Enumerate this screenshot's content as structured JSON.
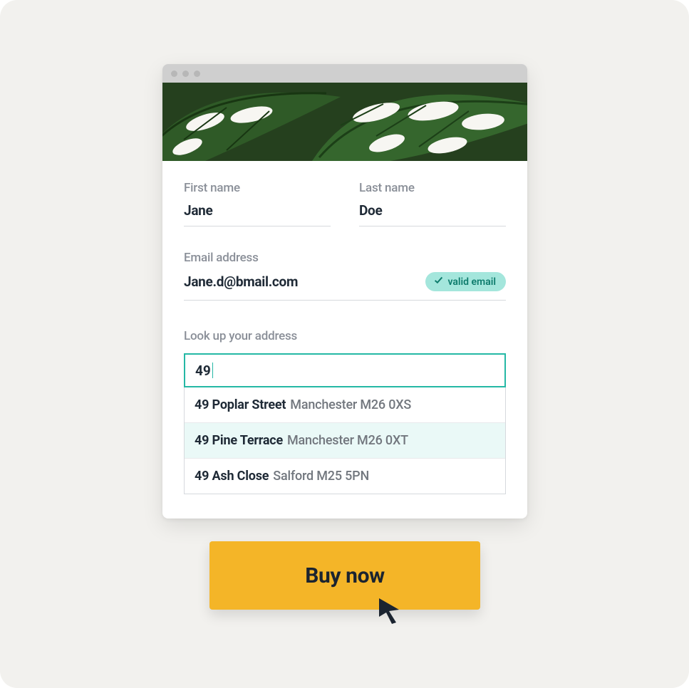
{
  "form": {
    "first_name": {
      "label": "First name",
      "value": "Jane"
    },
    "last_name": {
      "label": "Last name",
      "value": "Doe"
    },
    "email": {
      "label": "Email address",
      "value": "Jane.d@bmail.com",
      "valid_badge": "valid email"
    },
    "address": {
      "label": "Look up your address",
      "query": "49",
      "suggestions": [
        {
          "bold": "49 Poplar Street",
          "rest": "Manchester M26 0XS",
          "highlighted": false
        },
        {
          "bold": "49 Pine Terrace",
          "rest": "Manchester M26 0XT",
          "highlighted": true
        },
        {
          "bold": "49 Ash Close",
          "rest": "Salford M25 5PN",
          "highlighted": false
        }
      ]
    }
  },
  "cta": {
    "label": "Buy now"
  }
}
